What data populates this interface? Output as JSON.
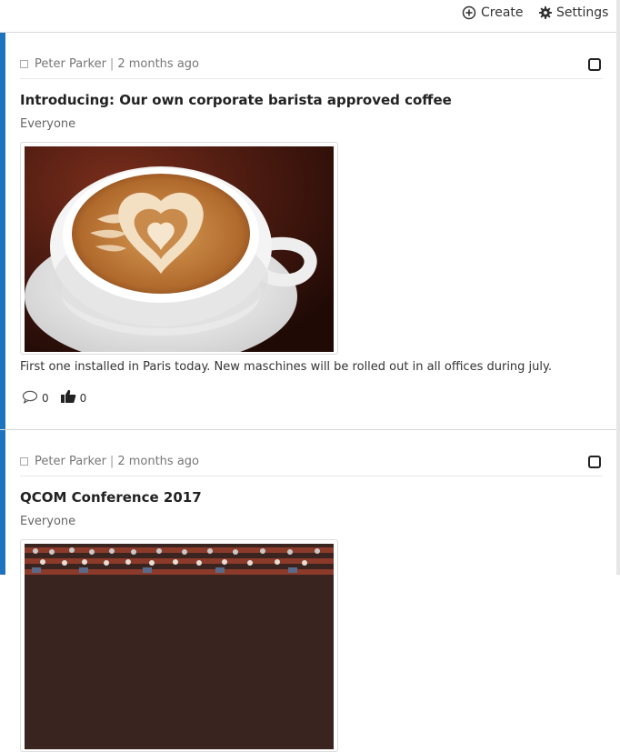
{
  "theme": {
    "accent": "#1e73be",
    "divider": "#d9d9d9"
  },
  "header": {
    "create_label": "Create",
    "settings_label": "Settings",
    "create_icon": "plus-circle-icon",
    "settings_icon": "gear-icon"
  },
  "posts": [
    {
      "author": "Peter Parker",
      "separator": "|",
      "time": "2 months ago",
      "title": "Introducing: Our own corporate barista approved coffee",
      "audience": "Everyone",
      "image_subject": "latte art coffee cup",
      "body": "First one installed in Paris today. New maschines will be rolled out in all offices during july.",
      "comments_count": "0",
      "likes_count": "0"
    },
    {
      "author": "Peter Parker",
      "separator": "|",
      "time": "2 months ago",
      "title": "QCOM Conference 2017",
      "audience": "Everyone",
      "image_subject": "conference audience"
    }
  ]
}
